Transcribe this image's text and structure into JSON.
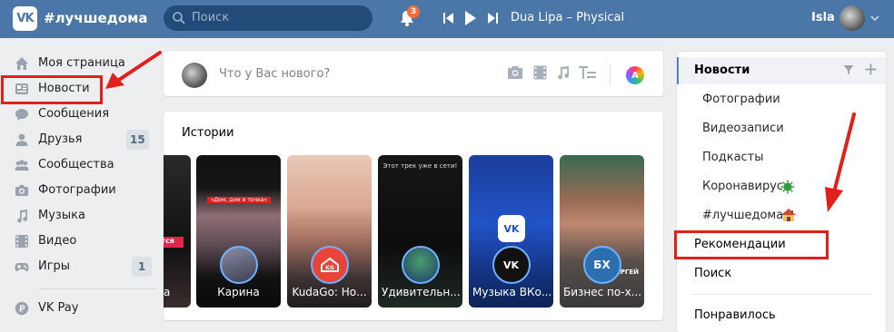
{
  "header": {
    "logo_text": "VK",
    "hashtag": "#лучшедома",
    "search_placeholder": "Поиск",
    "notification_count": "3",
    "track": "Dua Lipa – Physical",
    "user_name": "Isla"
  },
  "left_nav": {
    "items": [
      {
        "label": "Моя страница",
        "icon": "home-icon"
      },
      {
        "label": "Новости",
        "icon": "news-icon"
      },
      {
        "label": "Сообщения",
        "icon": "messages-icon"
      },
      {
        "label": "Друзья",
        "icon": "friends-icon",
        "count": "15"
      },
      {
        "label": "Сообщества",
        "icon": "communities-icon"
      },
      {
        "label": "Фотографии",
        "icon": "camera-icon"
      },
      {
        "label": "Музыка",
        "icon": "music-icon"
      },
      {
        "label": "Видео",
        "icon": "video-icon"
      },
      {
        "label": "Игры",
        "icon": "gamepad-icon",
        "count": "1"
      }
    ],
    "vkpay_label": "VK Pay"
  },
  "post_box": {
    "placeholder": "Что у Вас нового?"
  },
  "stories": {
    "title": "Истории",
    "items": [
      {
        "label": "а"
      },
      {
        "label": "Карина"
      },
      {
        "label": "KudaGo: Но..."
      },
      {
        "label": "Удивительн..."
      },
      {
        "label": "Музыка ВКо..."
      },
      {
        "label": "Бизнес по-х..."
      }
    ],
    "overlay_texts": {
      "karina": "«Дом, дом и точка»",
      "udiv": "Этот трек уже в сети!",
      "biz_avatar": "БХ",
      "biz_bottom": "МИРСЕРГЕЙ"
    }
  },
  "right_nav": {
    "news": "Новости",
    "sub": [
      "Фотографии",
      "Видеозаписи",
      "Подкасты",
      "Коронавирус",
      "#лучшедома"
    ],
    "recommendations": "Рекомендации",
    "search": "Поиск",
    "liked": "Понравилось"
  },
  "colors": {
    "header": "#4a76a8",
    "highlight": "#e0211b",
    "accent": "#5181b8"
  }
}
